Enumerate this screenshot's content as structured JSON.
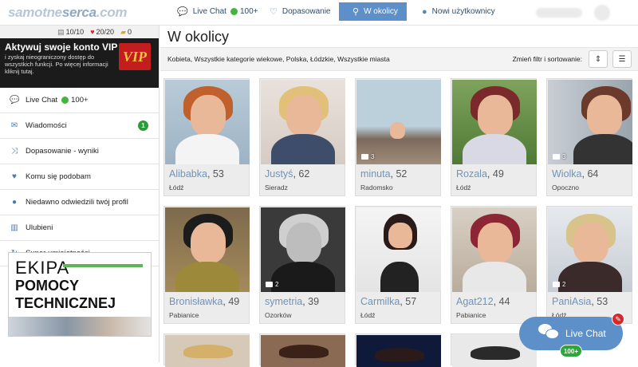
{
  "header": {
    "logo_part1": "samotne",
    "logo_part2": "serca",
    "logo_part3": ".com",
    "nav": [
      {
        "label": "Live Chat",
        "count": "100+",
        "icon": "chat-icon"
      },
      {
        "label": "Dopasowanie",
        "icon": "heart-outline-icon"
      },
      {
        "label": "W okolicy",
        "icon": "location-pin-icon",
        "active": true
      },
      {
        "label": "Nowi użytkownicy",
        "icon": "user-icon"
      }
    ]
  },
  "sidebar": {
    "stats": {
      "messages": "10/10",
      "hearts": "20/20",
      "coins": "0"
    },
    "vip": {
      "title": "Aktywuj swoje konto VIP",
      "desc": "i zyskaj nieograniczony dostęp do wszystkich funkcji. Po więcej informacji kliknij tutaj.",
      "badge": "VIP"
    },
    "items": [
      {
        "label": "Live Chat",
        "count": "100+",
        "icon": "chat-icon"
      },
      {
        "label": "Wiadomości",
        "badge": "1",
        "icon": "envelope-icon"
      },
      {
        "label": "Dopasowanie - wyniki",
        "icon": "shuffle-icon"
      },
      {
        "label": "Komu się podobam",
        "icon": "heart-icon"
      },
      {
        "label": "Niedawno odwiedzili twój profil",
        "icon": "user-icon"
      },
      {
        "label": "Ulubieni",
        "icon": "favorites-icon"
      },
      {
        "label": "Super umiejętności",
        "icon": "refresh-icon"
      }
    ],
    "banner": {
      "line1": "EKIPA",
      "line2": "POMOCY",
      "line3": "TECHNICZNEJ"
    }
  },
  "main": {
    "title": "W okolicy",
    "filter_text": "Kobieta, Wszystkie kategorie wiekowe, Polska, Łódzkie, Wszystkie miasta",
    "change_label": "Zmień filtr i sortowanie:",
    "profiles": [
      {
        "name": "Alibabka",
        "age": ", 53",
        "city": "Łódź",
        "photos": ""
      },
      {
        "name": "Justyś",
        "age": ", 62",
        "city": "Sieradz",
        "photos": ""
      },
      {
        "name": "minuta",
        "age": ", 52",
        "city": "Radomsko",
        "photos": "3"
      },
      {
        "name": "Rozala",
        "age": ", 49",
        "city": "Łódź",
        "photos": ""
      },
      {
        "name": "Wiolka",
        "age": ", 64",
        "city": "Opoczno",
        "photos": "3"
      },
      {
        "name": "Bronisławka",
        "age": ", 49",
        "city": "Pabianice",
        "photos": ""
      },
      {
        "name": "symetria",
        "age": ", 39",
        "city": "Ozorków",
        "photos": "2"
      },
      {
        "name": "Carmilka",
        "age": ", 57",
        "city": "Łódź",
        "photos": ""
      },
      {
        "name": "Agat212",
        "age": ", 44",
        "city": "Pabianice",
        "photos": ""
      },
      {
        "name": "PaniAsia",
        "age": ", 53",
        "city": "Łódź",
        "photos": "2"
      }
    ]
  },
  "livechat": {
    "label": "Live Chat",
    "count": "100+"
  },
  "colors": {
    "accent": "#5d8fc8",
    "online": "#3fb73f",
    "vip_red": "#c41d1d",
    "name_link": "#6e93bd"
  }
}
